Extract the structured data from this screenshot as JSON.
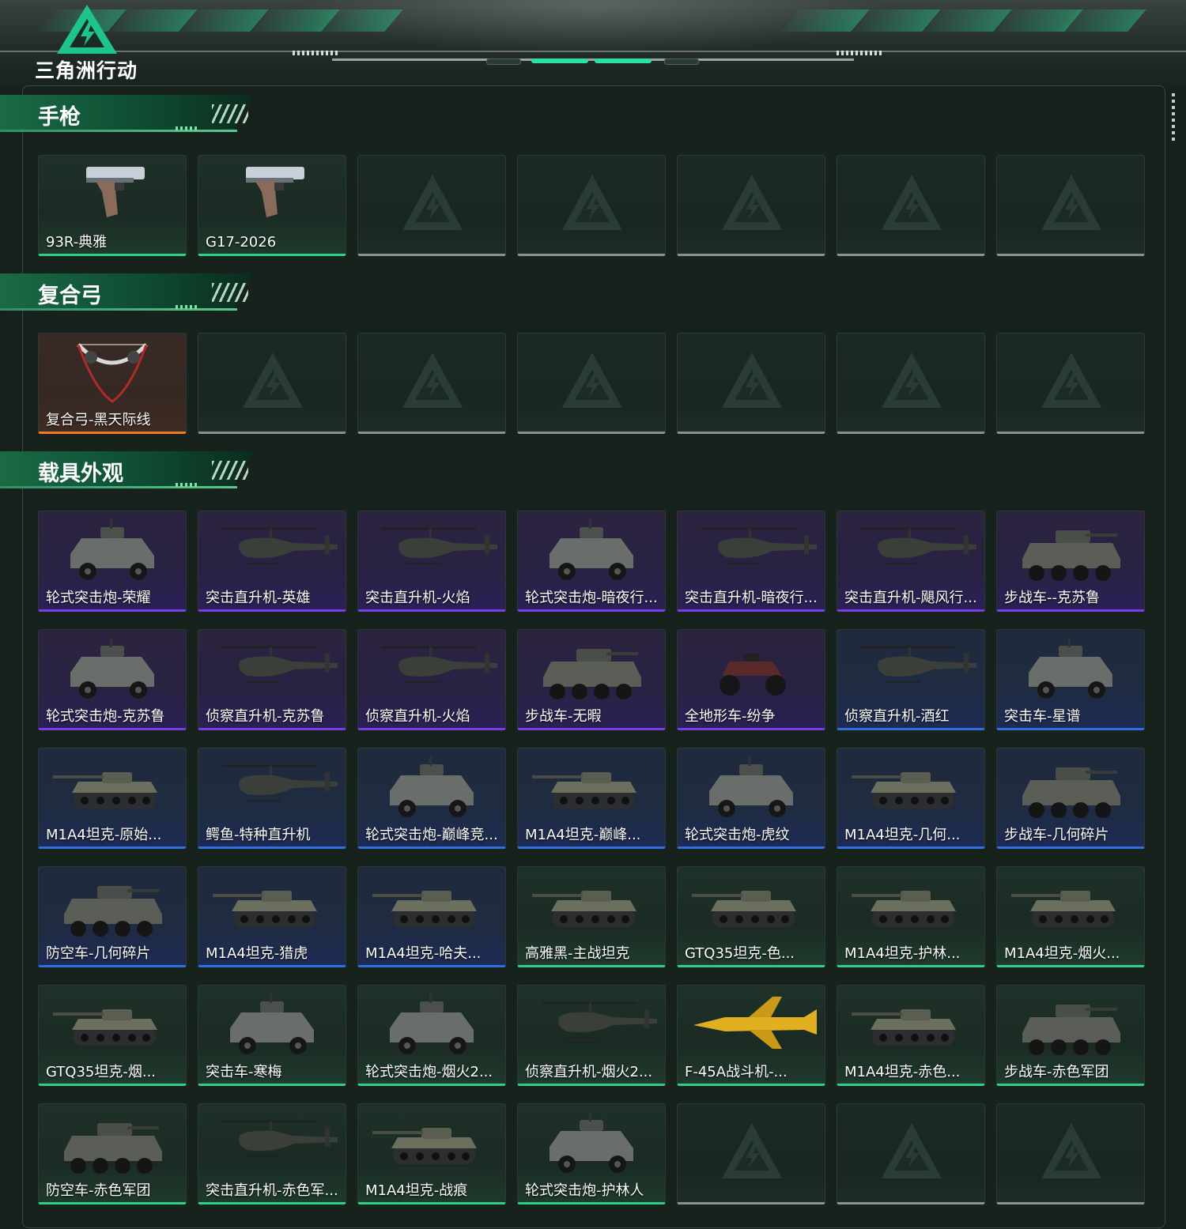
{
  "app": {
    "logo_text": "三角洲行动"
  },
  "sections": [
    {
      "title": "手枪",
      "items": [
        {
          "label": "93R-典雅",
          "rarity": "green",
          "icon": "pistol-icon"
        },
        {
          "label": "G17-2026",
          "rarity": "green",
          "icon": "pistol-icon"
        },
        {
          "label": "",
          "rarity": "empty"
        },
        {
          "label": "",
          "rarity": "empty"
        },
        {
          "label": "",
          "rarity": "empty"
        },
        {
          "label": "",
          "rarity": "empty"
        },
        {
          "label": "",
          "rarity": "empty"
        }
      ]
    },
    {
      "title": "复合弓",
      "items": [
        {
          "label": "复合弓-黑天际线",
          "rarity": "orange",
          "icon": "bow-icon"
        },
        {
          "label": "",
          "rarity": "empty"
        },
        {
          "label": "",
          "rarity": "empty"
        },
        {
          "label": "",
          "rarity": "empty"
        },
        {
          "label": "",
          "rarity": "empty"
        },
        {
          "label": "",
          "rarity": "empty"
        },
        {
          "label": "",
          "rarity": "empty"
        }
      ]
    },
    {
      "title": "载具外观",
      "items": [
        {
          "label": "轮式突击炮-荣耀",
          "rarity": "purple",
          "icon": "armored-car-icon"
        },
        {
          "label": "突击直升机-英雄",
          "rarity": "purple",
          "icon": "helicopter-icon"
        },
        {
          "label": "突击直升机-火焰",
          "rarity": "purple",
          "icon": "helicopter-icon"
        },
        {
          "label": "轮式突击炮-暗夜行...",
          "rarity": "purple",
          "icon": "armored-car-icon"
        },
        {
          "label": "突击直升机-暗夜行...",
          "rarity": "purple",
          "icon": "helicopter-icon"
        },
        {
          "label": "突击直升机-飓风行...",
          "rarity": "purple",
          "icon": "helicopter-icon"
        },
        {
          "label": "步战车--克苏鲁",
          "rarity": "purple",
          "icon": "ifv-icon"
        },
        {
          "label": "轮式突击炮-克苏鲁",
          "rarity": "purple",
          "icon": "armored-car-icon"
        },
        {
          "label": "侦察直升机-克苏鲁",
          "rarity": "purple",
          "icon": "helicopter-icon"
        },
        {
          "label": "侦察直升机-火焰",
          "rarity": "purple",
          "icon": "helicopter-icon"
        },
        {
          "label": "步战车-无暇",
          "rarity": "purple",
          "icon": "ifv-icon"
        },
        {
          "label": "全地形车-纷争",
          "rarity": "purple",
          "icon": "atv-icon"
        },
        {
          "label": "侦察直升机-酒红",
          "rarity": "blue",
          "icon": "helicopter-icon"
        },
        {
          "label": "突击车-星谱",
          "rarity": "blue",
          "icon": "armored-car-icon"
        },
        {
          "label": "M1A4坦克-原始...",
          "rarity": "blue",
          "icon": "tank-icon"
        },
        {
          "label": "鳄鱼-特种直升机",
          "rarity": "blue",
          "icon": "helicopter-icon"
        },
        {
          "label": "轮式突击炮-巅峰竞...",
          "rarity": "blue",
          "icon": "armored-car-icon"
        },
        {
          "label": "M1A4坦克-巅峰...",
          "rarity": "blue",
          "icon": "tank-icon"
        },
        {
          "label": "轮式突击炮-虎纹",
          "rarity": "blue",
          "icon": "armored-car-icon"
        },
        {
          "label": "M1A4坦克-几何...",
          "rarity": "blue",
          "icon": "tank-icon"
        },
        {
          "label": "步战车-几何碎片",
          "rarity": "blue",
          "icon": "ifv-icon"
        },
        {
          "label": "防空车-几何碎片",
          "rarity": "blue",
          "icon": "ifv-icon"
        },
        {
          "label": "M1A4坦克-猎虎",
          "rarity": "blue",
          "icon": "tank-icon"
        },
        {
          "label": "M1A4坦克-哈夫...",
          "rarity": "blue",
          "icon": "tank-icon"
        },
        {
          "label": "高雅黑-主战坦克",
          "rarity": "green",
          "icon": "tank-icon"
        },
        {
          "label": "GTQ35坦克-色...",
          "rarity": "green",
          "icon": "tank-icon"
        },
        {
          "label": "M1A4坦克-护林...",
          "rarity": "green",
          "icon": "tank-icon"
        },
        {
          "label": "M1A4坦克-烟火...",
          "rarity": "green",
          "icon": "tank-icon"
        },
        {
          "label": "GTQ35坦克-烟...",
          "rarity": "green",
          "icon": "tank-icon"
        },
        {
          "label": "突击车-寒梅",
          "rarity": "green",
          "icon": "armored-car-icon"
        },
        {
          "label": "轮式突击炮-烟火2...",
          "rarity": "green",
          "icon": "armored-car-icon"
        },
        {
          "label": "侦察直升机-烟火2...",
          "rarity": "green",
          "icon": "helicopter-icon"
        },
        {
          "label": "F-45A战斗机-...",
          "rarity": "green",
          "icon": "jet-icon"
        },
        {
          "label": "M1A4坦克-赤色...",
          "rarity": "green",
          "icon": "tank-icon"
        },
        {
          "label": "步战车-赤色军团",
          "rarity": "green",
          "icon": "ifv-icon"
        },
        {
          "label": "防空车-赤色军团",
          "rarity": "green",
          "icon": "ifv-icon"
        },
        {
          "label": "突击直升机-赤色军...",
          "rarity": "green",
          "icon": "helicopter-icon"
        },
        {
          "label": "M1A4坦克-战痕",
          "rarity": "green",
          "icon": "tank-icon"
        },
        {
          "label": "轮式突击炮-护林人",
          "rarity": "green",
          "icon": "armored-car-icon"
        },
        {
          "label": "",
          "rarity": "empty"
        },
        {
          "label": "",
          "rarity": "empty"
        },
        {
          "label": "",
          "rarity": "empty"
        }
      ]
    }
  ],
  "colors": {
    "green": "#2fcf86",
    "purple": "#7a3ee6",
    "blue": "#2f6fe0",
    "orange": "#ef7a25",
    "empty": "#8c908e",
    "accent": "#23c28a"
  }
}
